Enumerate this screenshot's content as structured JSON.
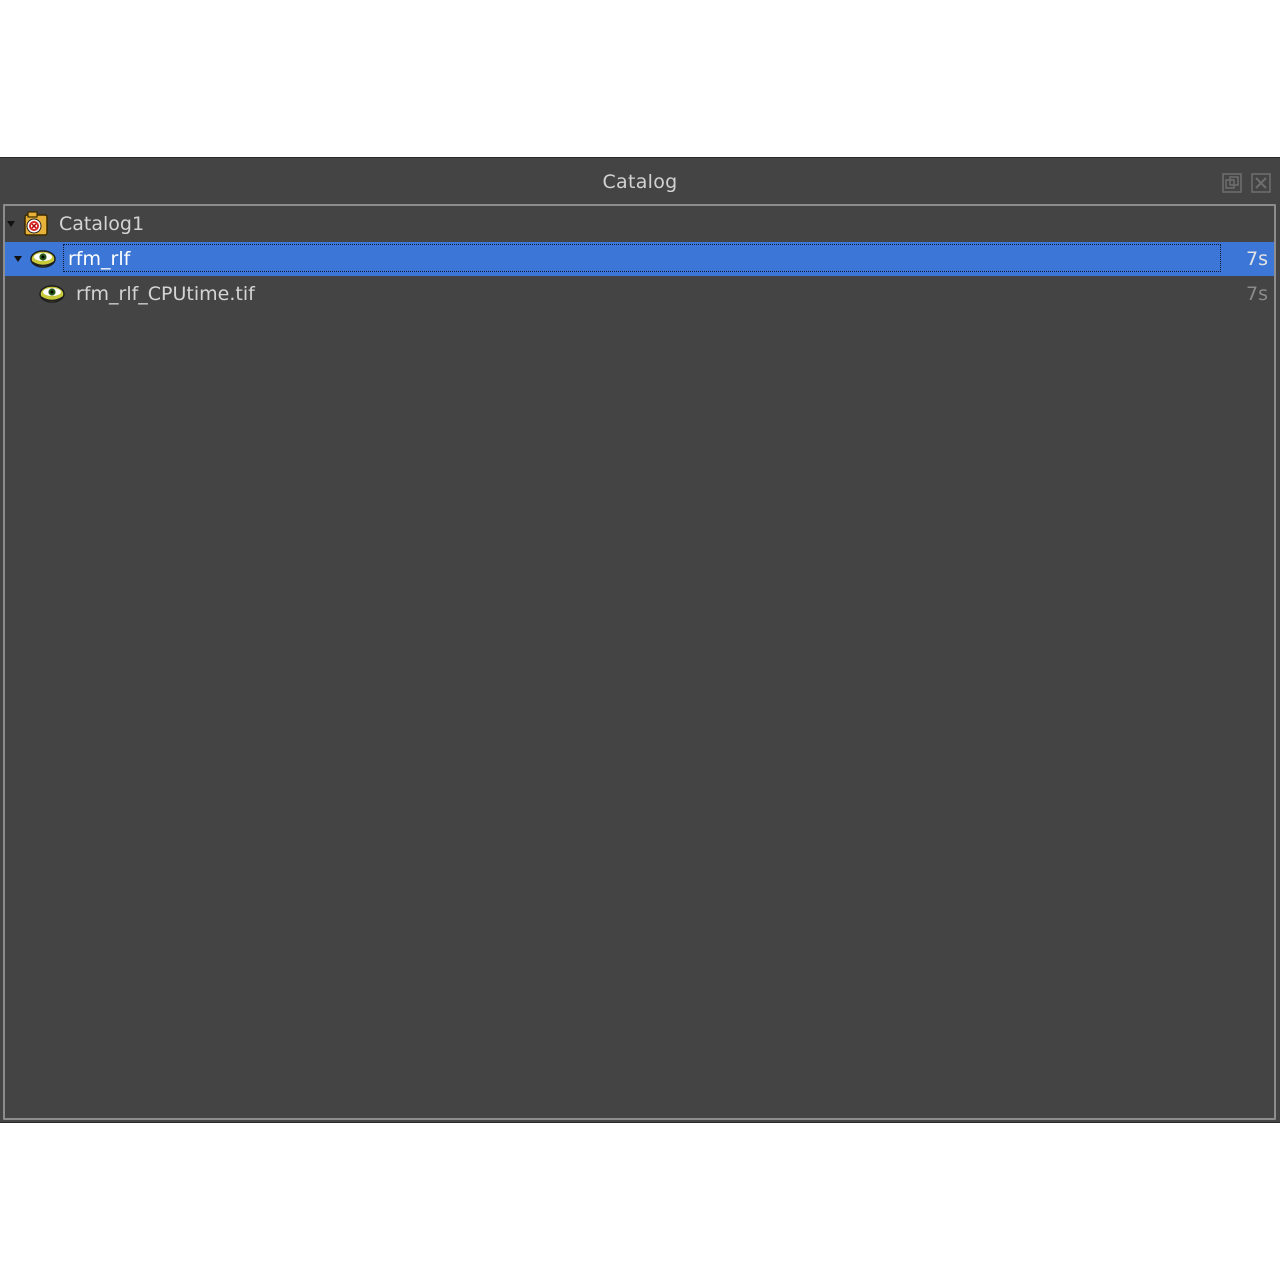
{
  "window": {
    "title": "Catalog",
    "float_button": "float-icon",
    "close_button": "close-icon"
  },
  "colors": {
    "background": "#444444",
    "selection": "#3c76d6",
    "title_text": "#d2d2d2",
    "dim_text": "#8a8a8a"
  },
  "tree": {
    "rows": [
      {
        "label": "Catalog1",
        "time": "",
        "icon": "catalog-icon",
        "expanded": true,
        "selected": false
      },
      {
        "label": "rfm_rlf",
        "time": "7s",
        "icon": "eye-icon",
        "expanded": true,
        "selected": true
      },
      {
        "label": "rfm_rlf_CPUtime.tif",
        "time": "7s",
        "icon": "eye-icon",
        "expanded": false,
        "selected": false
      }
    ]
  }
}
